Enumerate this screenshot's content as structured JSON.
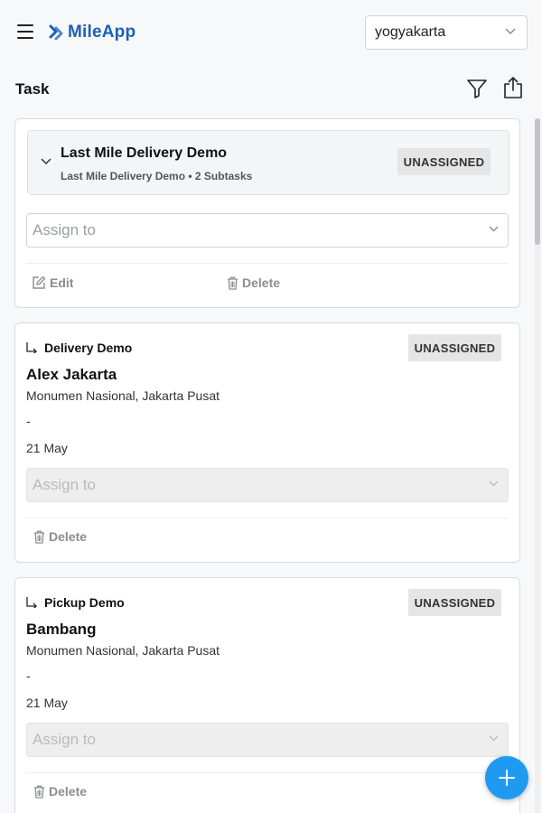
{
  "app": {
    "brand": "MileApp",
    "brand_color": "#1c5fb8",
    "accent_color": "#1e9bf0"
  },
  "header": {
    "city": {
      "selected": "yogyakarta",
      "icon": "chevron-down-icon"
    },
    "menu_icon": "hamburger-icon"
  },
  "page": {
    "title": "Task",
    "filter_icon": "filter-icon",
    "export_icon": "share-icon"
  },
  "tasks": {
    "group": {
      "title": "Last Mile Delivery Demo",
      "subtitle": "Last Mile Delivery Demo • 2 Subtasks",
      "status": "UNASSIGNED",
      "assign_placeholder": "Assign to",
      "edit_label": "Edit",
      "delete_label": "Delete"
    },
    "items": [
      {
        "type": "Delivery Demo",
        "status": "UNASSIGNED",
        "name": "Alex Jakarta",
        "address": "Monumen Nasional, Jakarta Pusat",
        "note": "-",
        "date": "21 May",
        "assign_placeholder": "Assign to",
        "delete_label": "Delete"
      },
      {
        "type": "Pickup Demo",
        "status": "UNASSIGNED",
        "name": "Bambang",
        "address": "Monumen Nasional, Jakarta Pusat",
        "note": "-",
        "date": "21 May",
        "assign_placeholder": "Assign to",
        "delete_label": "Delete"
      }
    ]
  },
  "fab": {
    "icon": "plus-icon"
  }
}
